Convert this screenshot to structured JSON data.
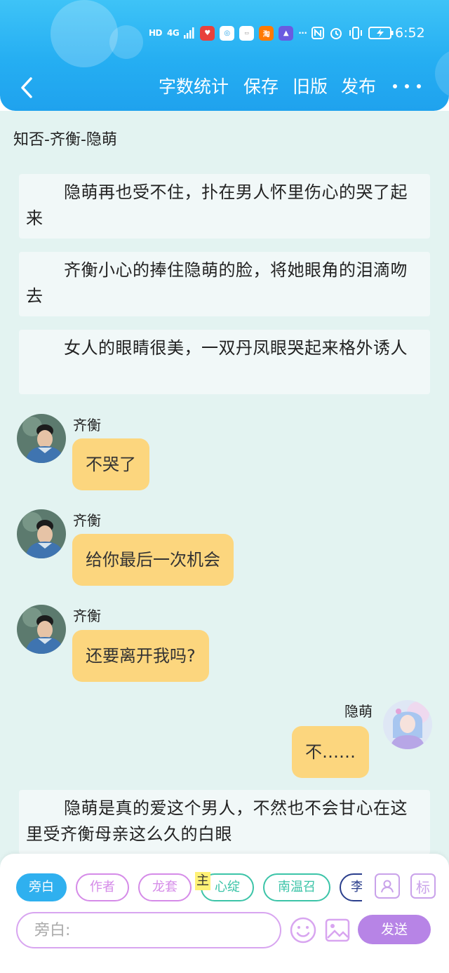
{
  "status_bar": {
    "left_icons": [
      "HD",
      "4G",
      "signal-icon",
      "app-icon-red",
      "app-icon-white",
      "app-icon-huawei",
      "app-icon-taobao",
      "app-icon-cap",
      "more-dots-icon",
      "nfc-icon",
      "alarm-icon",
      "vibrate-icon",
      "battery-icon"
    ],
    "hd_label": "HD",
    "network_label": "4G",
    "time": "6:52"
  },
  "toolbar": {
    "word_count_label": "字数统计",
    "save_label": "保存",
    "old_version_label": "旧版",
    "publish_label": "发布"
  },
  "document": {
    "title": "知否-齐衡-隐萌"
  },
  "messages": [
    {
      "type": "narration",
      "text": "隐萌再也受不住，扑在男人怀里伤心的哭了起来"
    },
    {
      "type": "narration",
      "text": "齐衡小心的捧住隐萌的脸，将她眼角的泪滴吻去"
    },
    {
      "type": "narration",
      "text": "女人的眼睛很美，一双丹凤眼哭起来格外诱人"
    },
    {
      "type": "dialogue",
      "side": "left",
      "speaker": "齐衡",
      "text": "不哭了"
    },
    {
      "type": "dialogue",
      "side": "left",
      "speaker": "齐衡",
      "text": "给你最后一次机会"
    },
    {
      "type": "dialogue",
      "side": "left",
      "speaker": "齐衡",
      "text": "还要离开我吗?"
    },
    {
      "type": "dialogue",
      "side": "right",
      "speaker": "隐萌",
      "text": "不……"
    },
    {
      "type": "narration",
      "text": "隐萌是真的爱这个男人，不然也不会甘心在这里受齐衡母亲这么久的白眼"
    }
  ],
  "role_bar": {
    "roles": [
      {
        "label": "旁白",
        "selected": true
      },
      {
        "label": "作者"
      },
      {
        "label": "龙套"
      },
      {
        "label": "心绽"
      },
      {
        "label": "南温召"
      },
      {
        "label": "李"
      }
    ],
    "main_role_tag": "主",
    "mark_icon_label": "标"
  },
  "composer": {
    "placeholder": "旁白:",
    "send_label": "发送"
  },
  "colors": {
    "header_blue": "#25aef2",
    "content_bg": "#e3f3f1",
    "dialogue_bubble": "#fcd67e",
    "selected_chip": "#2fb0ef",
    "send_button": "#b784e6",
    "author_chip": "#d58be8",
    "teal_chip": "#3cc4a8",
    "navy_chip": "#2a3e8c"
  }
}
